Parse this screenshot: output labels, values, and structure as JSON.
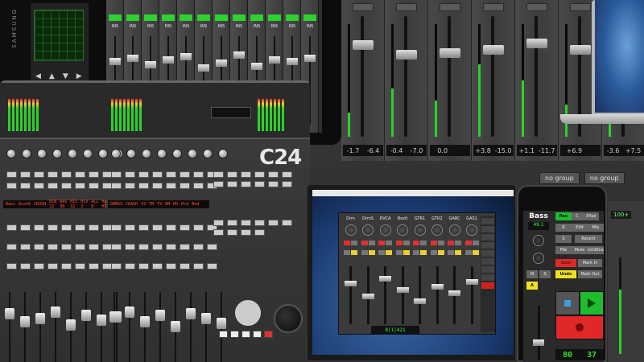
{
  "background_mixer": {
    "readouts": [
      {
        "a": "-1.7",
        "b": "-6.4"
      },
      {
        "a": "-0.4",
        "b": "-7.0"
      },
      {
        "a": "0.0",
        "b": ""
      },
      {
        "a": "+3.8",
        "b": "-15.0"
      },
      {
        "a": "+1.1",
        "b": "-11.7"
      },
      {
        "a": "+6.9",
        "b": ""
      },
      {
        "a": "-3.6",
        "b": "+7.5"
      }
    ],
    "groups": [
      "no group",
      "no group"
    ],
    "right_label": "100+"
  },
  "samsung_tablet": {
    "brand": "SAMSUNG",
    "nav": [
      "◀",
      "▲",
      "▼",
      "▶"
    ]
  },
  "ipad_mixer": {
    "insert_label": "INS"
  },
  "console": {
    "logo": "C24",
    "lcd_left": [
      "Bass",
      "Acon6",
      "CROSH",
      "BIN 32",
      "BAS 90",
      "HIS 32",
      "HIV 3",
      "ALL 8",
      "HU HT"
    ],
    "lcd_right": [
      "DRMSS",
      "CRASH",
      "V3",
      "TM",
      "FX",
      "RM",
      "RO",
      "Hrd",
      "Bnd"
    ]
  },
  "laptop_app": {
    "menu": [
      "",
      "",
      "",
      "",
      "",
      "",
      "",
      ""
    ],
    "channels": [
      "Drm",
      "DrmS",
      "DVCA",
      "Bsstt",
      "GTR1",
      "GTR2",
      "GARC",
      "GAS1",
      ""
    ],
    "timecode": "8|1|421"
  },
  "iphone": {
    "title": "Bass",
    "value": "49.1",
    "labels": {
      "pan": "Pan",
      "c": "C",
      "xpad": "XPad",
      "r": "R",
      "edit": "Edit",
      "mix": "Mix",
      "s": "S",
      "recent": "Recent",
      "file": "File",
      "mute": "Mute",
      "gridsnap": "GridSnap",
      "save": "Save",
      "mark_in": "Mark In",
      "undo": "Undo",
      "mark_out": "Mark Out",
      "m": "M",
      "big_s": "S",
      "a": "A"
    },
    "counter": [
      "80",
      "37"
    ]
  }
}
